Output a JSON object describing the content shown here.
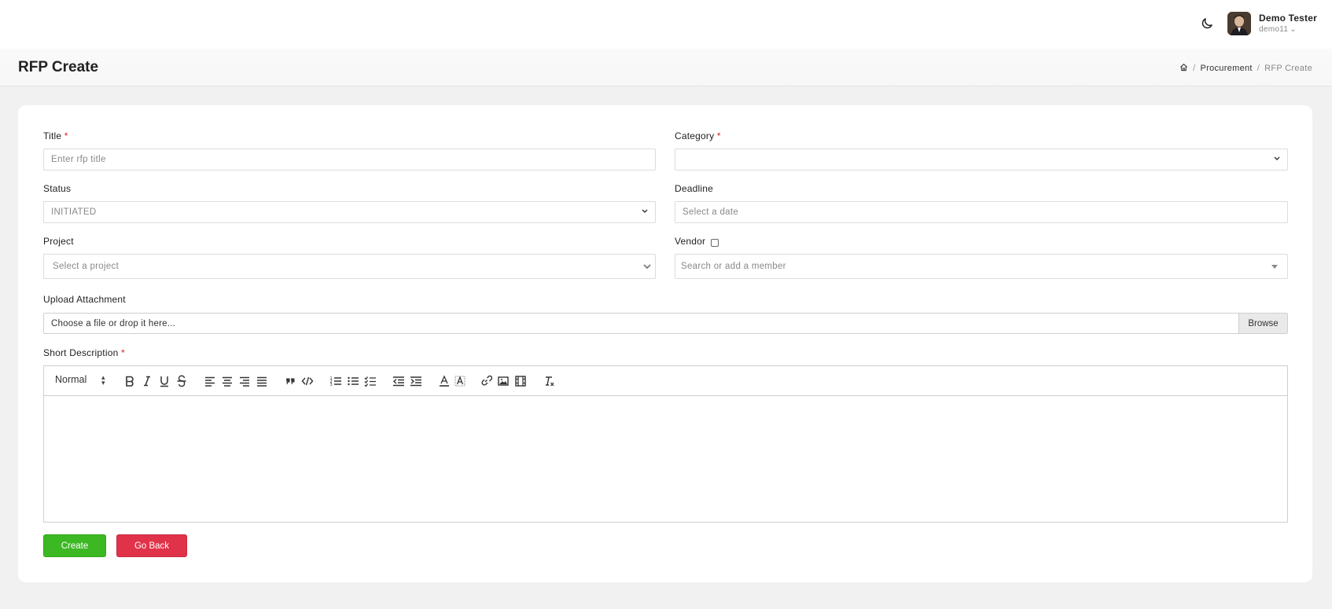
{
  "user": {
    "name": "Demo Tester",
    "handle": "demo11"
  },
  "page": {
    "title": "RFP Create"
  },
  "breadcrumb": {
    "parent": "Procurement",
    "current": "RFP Create"
  },
  "form": {
    "title": {
      "label": "Title",
      "required": "*",
      "placeholder": "Enter rfp title"
    },
    "category": {
      "label": "Category",
      "required": "*",
      "value": ""
    },
    "status": {
      "label": "Status",
      "value": "INITIATED"
    },
    "deadline": {
      "label": "Deadline",
      "placeholder": "Select a date"
    },
    "project": {
      "label": "Project",
      "placeholder": "Select a project"
    },
    "vendor": {
      "label": "Vendor",
      "checked": false,
      "placeholder": "Search or add a member"
    },
    "attachment": {
      "label": "Upload Attachment",
      "placeholder": "Choose a file or drop it here...",
      "browse_label": "Browse"
    },
    "description": {
      "label": "Short Description",
      "required": "*",
      "heading_select": "Normal"
    }
  },
  "buttons": {
    "create": "Create",
    "back": "Go Back"
  },
  "colors": {
    "create": "#3cb922",
    "back": "#e0334a",
    "required": "#e0202e"
  }
}
